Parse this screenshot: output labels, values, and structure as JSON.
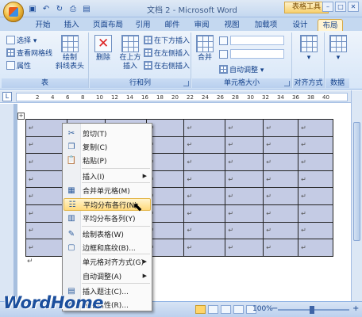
{
  "titlebar": {
    "title": "文档 2 - Microsoft Word",
    "tool_tab_group": "表格工具",
    "window_buttons": [
      "minimize",
      "maximize",
      "close"
    ]
  },
  "qat": {
    "icons": [
      "save-icon",
      "undo-icon",
      "redo-icon",
      "print-icon",
      "open-icon"
    ]
  },
  "tabs": [
    "开始",
    "插入",
    "页面布局",
    "引用",
    "邮件",
    "审阅",
    "视图",
    "加载项",
    "设计",
    "布局"
  ],
  "active_tab": "布局",
  "ribbon": {
    "table_group": {
      "label": "表",
      "select": "选择 ▾",
      "gridlines": "查看网格线",
      "properties": "属性",
      "draw_line1": "绘制",
      "draw_line2": "斜线表头"
    },
    "rows_cols_group": {
      "label": "行和列",
      "delete": "删除",
      "insert_above_line1": "在上方",
      "insert_above_line2": "插入",
      "insert_below": "在下方插入",
      "insert_left": "在左侧插入",
      "insert_right": "在右侧插入"
    },
    "cell_size_group": {
      "label": "单元格大小",
      "merge": "合并",
      "autofit": "自动调整 ▾"
    },
    "align_group": {
      "label": "对齐方式"
    },
    "data_group": {
      "label": "数据"
    }
  },
  "ruler": {
    "ticks": [
      "2",
      "4",
      "6",
      "8",
      "10",
      "12",
      "14",
      "16",
      "18",
      "20",
      "22",
      "24",
      "26",
      "28",
      "30",
      "32",
      "34",
      "36",
      "38",
      "40"
    ]
  },
  "table": {
    "rows": 8,
    "cols": 8,
    "cell_mark": "↵"
  },
  "context_menu": {
    "items": [
      {
        "label": "剪切(T)",
        "icon": "scissors-icon"
      },
      {
        "label": "复制(C)",
        "icon": "copy-icon"
      },
      {
        "label": "粘贴(P)",
        "icon": "paste-icon"
      },
      {
        "label": "插入(I)",
        "icon": "",
        "submenu": true
      },
      {
        "label": "合并单元格(M)",
        "icon": "merge-cells-icon"
      },
      {
        "label": "平均分布各行(N)",
        "icon": "distribute-rows-icon",
        "highlighted": true
      },
      {
        "label": "平均分布各列(Y)",
        "icon": "distribute-columns-icon"
      },
      {
        "label": "绘制表格(W)",
        "icon": "draw-table-icon"
      },
      {
        "label": "边框和底纹(B)...",
        "icon": "borders-icon"
      },
      {
        "label": "单元格对齐方式(G)",
        "icon": "",
        "submenu": true
      },
      {
        "label": "自动调整(A)",
        "icon": "",
        "submenu": true
      },
      {
        "label": "插入题注(C)...",
        "icon": "caption-icon"
      },
      {
        "label": "表格属性(R)...",
        "icon": "table-properties-icon"
      }
    ]
  },
  "statusbar": {
    "zoom": "100%"
  },
  "watermark": "WordHome"
}
